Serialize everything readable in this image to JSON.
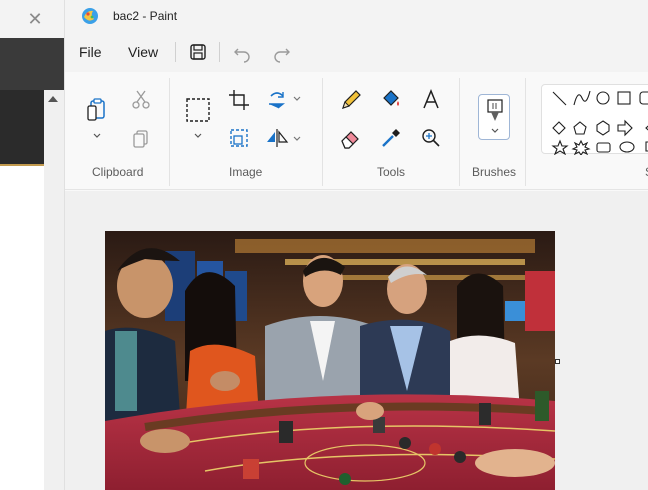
{
  "background_window": {
    "close_glyph": "✕"
  },
  "window": {
    "title": "bac2 - Paint"
  },
  "menu": {
    "file_label": "File",
    "view_label": "View"
  },
  "ribbon": {
    "groups": {
      "clipboard": "Clipboard",
      "image": "Image",
      "tools": "Tools",
      "brushes": "Brushes",
      "shapes_partial": "S"
    }
  },
  "colors": {
    "accent": "#1a73c8",
    "titlebar": "#f3f3f3",
    "table_felt": "#a8283a"
  }
}
